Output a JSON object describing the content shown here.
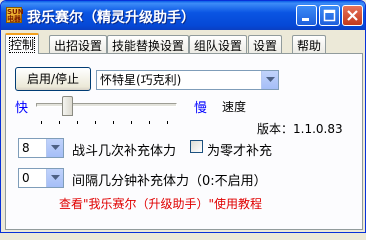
{
  "window": {
    "title": "我乐赛尔（精灵升级助手）",
    "icon_text_top": "SUN",
    "icon_text_bottom": "电器"
  },
  "tabs": [
    {
      "label": "控制",
      "active": true
    },
    {
      "label": "出招设置",
      "active": false
    },
    {
      "label": "技能替换设置",
      "active": false
    },
    {
      "label": "组队设置",
      "active": false
    },
    {
      "label": "设置",
      "active": false
    },
    {
      "label": "帮助",
      "active": false
    }
  ],
  "control": {
    "toggle_button_label": "启用/停止",
    "pet_select_value": "怀特星(巧克利)",
    "speed": {
      "fast_label": "快",
      "slow_label": "慢",
      "title": "速度",
      "level": 0.2
    },
    "version_text": "版本：1.1.0.83",
    "battle_count": {
      "value": "8",
      "label": "战斗几次补充体力",
      "checkbox_label": "为零才补充",
      "checked": false
    },
    "interval": {
      "value": "0",
      "label": "间隔几分钟补充体力（0:不启用）"
    },
    "tutorial_link": "查看\"我乐赛尔（升级助手）\"使用教程"
  },
  "colors": {
    "title_bar": "#0a55e3",
    "accent_blue": "#0000ff",
    "link_red": "#e00000",
    "tab_highlight": "#f2a01e"
  }
}
